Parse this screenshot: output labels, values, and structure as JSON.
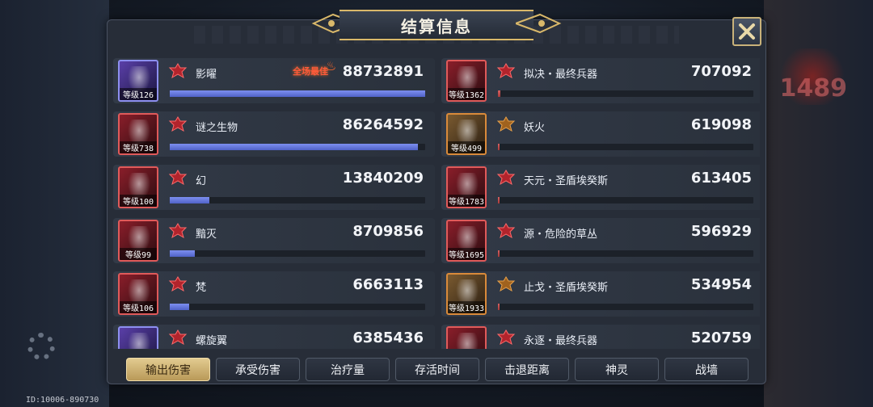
{
  "title": "结算信息",
  "user_id": "ID:10006-890730",
  "background": {
    "right_number": "1489"
  },
  "best_badge": "全场最佳",
  "left_team": [
    {
      "name": "影曜",
      "level": "126",
      "value": "88732891",
      "fill": 1.0,
      "frame": "blue",
      "best": true
    },
    {
      "name": "谜之生物",
      "level": "738",
      "value": "86264592",
      "fill": 0.972,
      "frame": "red"
    },
    {
      "name": "幻",
      "level": "100",
      "value": "13840209",
      "fill": 0.156,
      "frame": "red"
    },
    {
      "name": "黯灭",
      "level": "99",
      "value": "8709856",
      "fill": 0.098,
      "frame": "red"
    },
    {
      "name": "梵",
      "level": "106",
      "value": "6663113",
      "fill": 0.075,
      "frame": "red"
    },
    {
      "name": "螺旋翼",
      "level": "",
      "value": "6385436",
      "fill": 0.072,
      "frame": "blue"
    }
  ],
  "right_team": [
    {
      "name": "拟决・最终兵器",
      "level": "1362",
      "value": "707092",
      "fill": 0.008,
      "frame": "red"
    },
    {
      "name": "妖火",
      "level": "499",
      "value": "619098",
      "fill": 0.007,
      "frame": "orange"
    },
    {
      "name": "天元・圣盾埃癸斯",
      "level": "1783",
      "value": "613405",
      "fill": 0.007,
      "frame": "red"
    },
    {
      "name": "源・危险的草丛",
      "level": "1695",
      "value": "596929",
      "fill": 0.007,
      "frame": "red"
    },
    {
      "name": "止戈・圣盾埃癸斯",
      "level": "1933",
      "value": "534954",
      "fill": 0.006,
      "frame": "orange"
    },
    {
      "name": "永逐・最终兵器",
      "level": "",
      "value": "520759",
      "fill": 0.006,
      "frame": "red"
    }
  ],
  "tabs": [
    "输出伤害",
    "承受伤害",
    "治疗量",
    "存活时间",
    "击退距离",
    "神灵",
    "战墙"
  ],
  "active_tab": 0,
  "colors": {
    "accent_gold": "#d9b86a",
    "left_bar": "#5f72d8",
    "right_bar": "#c04848",
    "best_badge": "#ff5a3a"
  },
  "icons": {
    "close": "close-x-icon",
    "emblem": "faction-emblem-icon",
    "flame": "flame-icon"
  }
}
